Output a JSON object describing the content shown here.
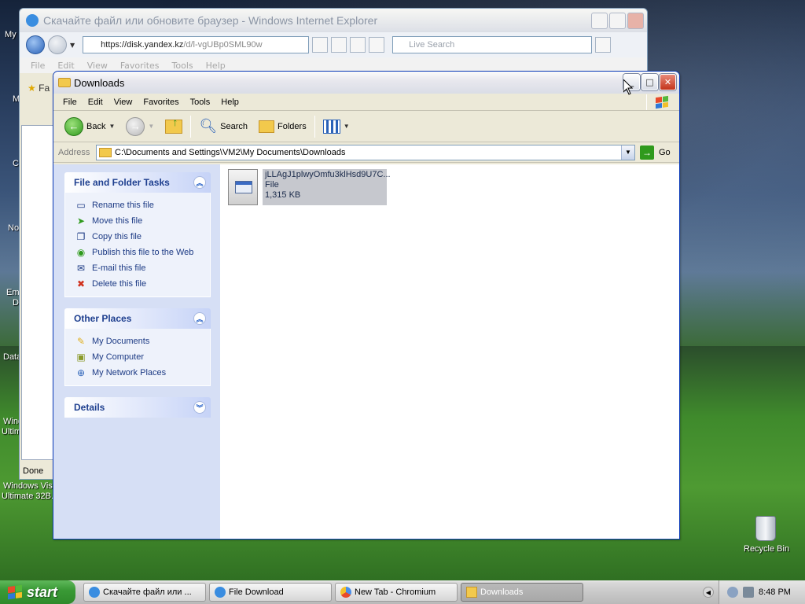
{
  "desktop": {
    "left_labels": [
      "My",
      "M",
      "C",
      "No",
      "Emb",
      "D",
      "Data",
      "Wind",
      "Ultim",
      "Windows Vist",
      "Ultimate 32B..."
    ],
    "recycle_bin_label": "Recycle Bin"
  },
  "ie_window": {
    "title": "Скачайте файл или обновите браузер - Windows Internet Explorer",
    "url_main": "https://disk.yandex.kz",
    "url_path": "/d/l-vgUBp0SML90w",
    "search_placeholder": "Live Search",
    "menu": [
      "File",
      "Edit",
      "View",
      "Favorites",
      "Tools",
      "Help"
    ],
    "fav_label": "Fa",
    "status": "Done"
  },
  "explorer": {
    "title": "Downloads",
    "menu": [
      "File",
      "Edit",
      "View",
      "Favorites",
      "Tools",
      "Help"
    ],
    "toolbar": {
      "back": "Back",
      "search": "Search",
      "folders": "Folders"
    },
    "address_label": "Address",
    "address_path": "C:\\Documents and Settings\\VM2\\My Documents\\Downloads",
    "go_label": "Go",
    "file_folder_tasks": {
      "title": "File and Folder Tasks",
      "items": [
        "Rename this file",
        "Move this file",
        "Copy this file",
        "Publish this file to the Web",
        "E-mail this file",
        "Delete this file"
      ]
    },
    "other_places": {
      "title": "Other Places",
      "items": [
        "My Documents",
        "My Computer",
        "My Network Places"
      ]
    },
    "details": {
      "title": "Details"
    },
    "file": {
      "name": "jLLAgJ1plwyOmfu3klHsd9U7C...",
      "type": "File",
      "size": "1,315 KB"
    }
  },
  "taskbar": {
    "start_label": "start",
    "tasks": [
      {
        "label": "Скачайте файл или ...",
        "active": false
      },
      {
        "label": "File Download",
        "active": false
      },
      {
        "label": "New Tab - Chromium",
        "active": false
      },
      {
        "label": "Downloads",
        "active": true
      }
    ],
    "clock": "8:48 PM"
  },
  "colors": {
    "xp_blue": "#215dc6",
    "start_green": "#3a9a36",
    "close_red": "#c3341b"
  }
}
